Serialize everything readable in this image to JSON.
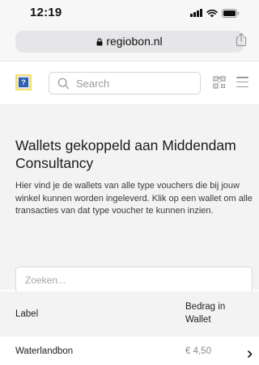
{
  "status_bar": {
    "time": "12:19",
    "icons": [
      "signal-icon",
      "wifi-icon",
      "battery-icon"
    ]
  },
  "browser": {
    "url": "regiobon.nl",
    "icons": [
      "lock-icon",
      "share-icon"
    ]
  },
  "header": {
    "logo_icon": "regiobon-logo",
    "search_placeholder": "Search",
    "icons": [
      "search-icon",
      "qr-code-icon",
      "hamburger-menu-icon"
    ]
  },
  "main": {
    "title": "Wallets gekoppeld aan Middendam Consultancy",
    "description": "Hier vind je de wallets van alle type vouchers die bij jouw winkel kunnen worden ingeleverd. Klik op een wallet om alle transacties van dat type voucher te kunnen inzien.",
    "search_placeholder": "Zoeken..."
  },
  "table": {
    "columns": [
      "Label",
      "Bedrag in Wallet"
    ],
    "rows": [
      {
        "label": "Waterlandbon",
        "amount": "€ 4,50"
      }
    ]
  },
  "colors": {
    "content_bg": "#f3f3f4",
    "logo_blue": "#2f5fb3",
    "logo_yellow": "#f5e06a",
    "muted_text": "#8a8a8e"
  }
}
